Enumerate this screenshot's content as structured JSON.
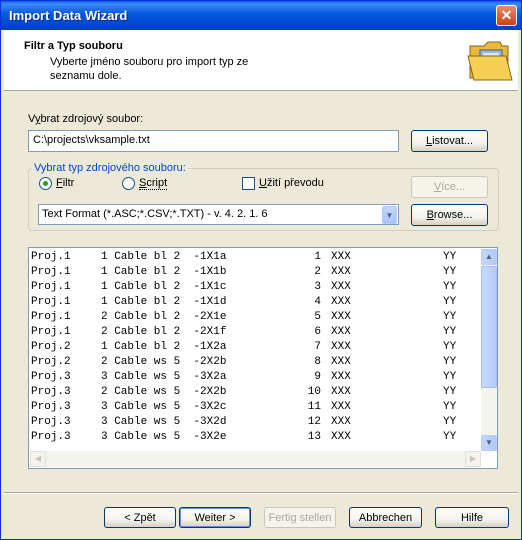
{
  "window": {
    "title": "Import Data Wizard",
    "close": "✕"
  },
  "header": {
    "title": "Filtr a Typ souboru",
    "description": "Vyberte jméno souboru pro import typ ze seznamu dole."
  },
  "source": {
    "label_pre": "V",
    "label_u": "y",
    "label_post": "brat zdrojový soubor:",
    "value": "C:\\projects\\vksample.txt",
    "browse_pre": "",
    "browse_u": "L",
    "browse_post": "istovat..."
  },
  "typegroup": {
    "label": "Vybrat typ zdrojového souboru:",
    "radio_filter_u": "F",
    "radio_filter_post": "iltr",
    "radio_script_pre": "",
    "radio_script_u": "S",
    "radio_script_post": "cript",
    "checkbox_pre": "",
    "checkbox_u": "U",
    "checkbox_post": "žití převodu",
    "more_pre": "",
    "more_u": "V",
    "more_post": "íce...",
    "format_value": "Text Format (*.ASC;*.CSV;*.TXT) - v. 4. 2. 1. 6",
    "browse2_pre": "",
    "browse2_u": "B",
    "browse2_post": "rowse..."
  },
  "preview_rows": [
    [
      "Proj.1",
      "1 Cable bl 2  -1X1a",
      "1",
      "XXX",
      "YY"
    ],
    [
      "Proj.1",
      "1 Cable bl 2  -1X1b",
      "2",
      "XXX",
      "YY"
    ],
    [
      "Proj.1",
      "1 Cable bl 2  -1X1c",
      "3",
      "XXX",
      "YY"
    ],
    [
      "Proj.1",
      "1 Cable bl 2  -1X1d",
      "4",
      "XXX",
      "YY"
    ],
    [
      "Proj.1",
      "2 Cable bl 2  -2X1e",
      "5",
      "XXX",
      "YY"
    ],
    [
      "Proj.1",
      "2 Cable bl 2  -2X1f",
      "6",
      "XXX",
      "YY"
    ],
    [
      "Proj.2",
      "1 Cable bl 2  -1X2a",
      "7",
      "XXX",
      "YY"
    ],
    [
      "Proj.2",
      "2 Cable ws 5  -2X2b",
      "8",
      "XXX",
      "YY"
    ],
    [
      "Proj.3",
      "3 Cable ws 5  -3X2a",
      "9",
      "XXX",
      "YY"
    ],
    [
      "Proj.3",
      "2 Cable ws 5  -2X2b",
      "10",
      "XXX",
      "YY"
    ],
    [
      "Proj.3",
      "3 Cable ws 5  -3X2c",
      "11",
      "XXX",
      "YY"
    ],
    [
      "Proj.3",
      "3 Cable ws 5  -3X2d",
      "12",
      "XXX",
      "YY"
    ],
    [
      "Proj.3",
      "3 Cable ws 5  -3X2e",
      "13",
      "XXX",
      "YY"
    ]
  ],
  "footer": {
    "back": "< Zpět",
    "next": "Weiter >",
    "finish": "Fertig stellen",
    "cancel": "Abbrechen",
    "help": "Hilfe"
  },
  "icons": {
    "folder": "folder-icon"
  },
  "colors": {
    "titlebar": "#0657e2",
    "dialog": "#ece9d8",
    "group_label": "#0046d5",
    "field_border": "#7f9db9"
  }
}
